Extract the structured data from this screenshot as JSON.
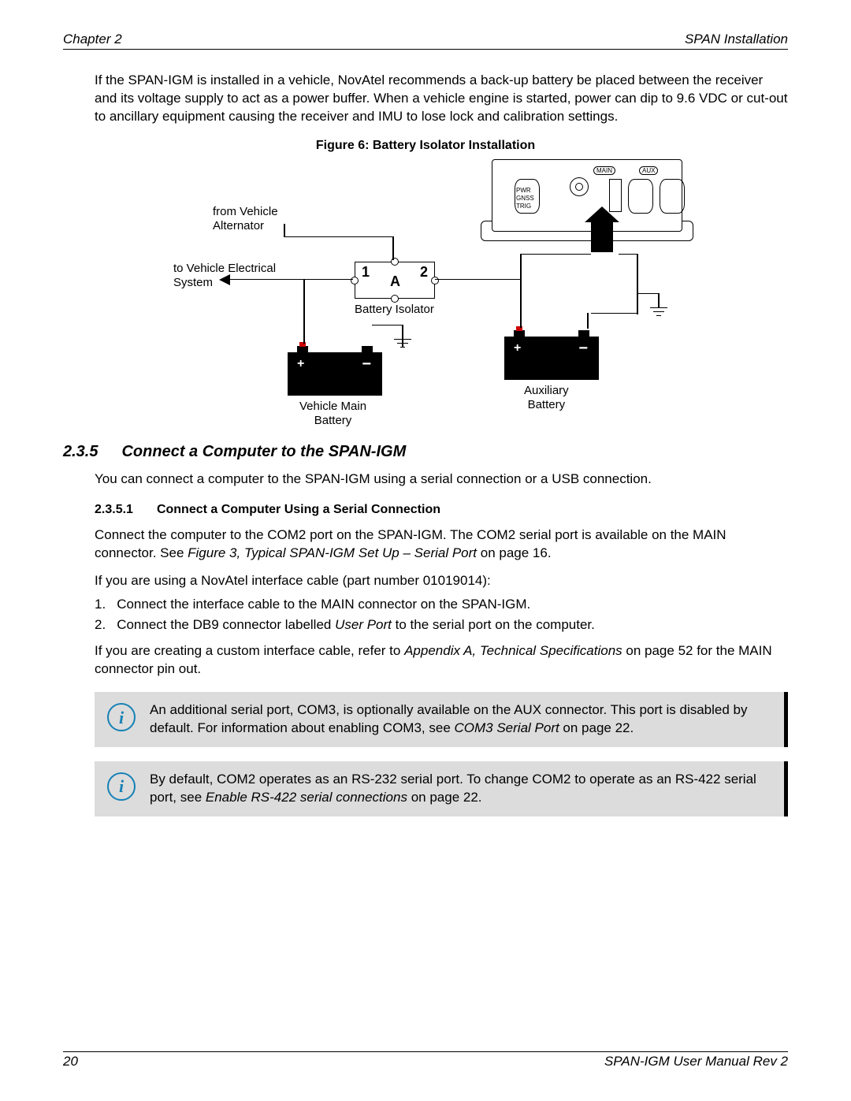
{
  "header": {
    "left": "Chapter 2",
    "right": "SPAN Installation"
  },
  "intro_para": "If the SPAN-IGM is installed in a vehicle, NovAtel recommends a back-up battery be placed between the receiver and its voltage supply to act as a power buffer. When a vehicle engine is started, power can dip to 9.6 VDC or cut-out to ancillary equipment causing the receiver and IMU to lose lock and calibration settings.",
  "figure": {
    "caption": "Figure 6: Battery Isolator Installation",
    "labels": {
      "from_alt_l1": "from Vehicle",
      "from_alt_l2": "Alternator",
      "to_sys_l1": "to Vehicle Electrical",
      "to_sys_l2": "System",
      "isolator": "Battery Isolator",
      "main_batt_l1": "Vehicle Main",
      "main_batt_l2": "Battery",
      "aux_batt_l1": "Auxiliary",
      "aux_batt_l2": "Battery",
      "dev_main": "MAIN",
      "dev_aux": "AUX",
      "dev_pwr": "PWR",
      "dev_gnss": "GNSS",
      "dev_trig": "TRIG"
    }
  },
  "section": {
    "num": "2.3.5",
    "title": "Connect a Computer to the SPAN-IGM"
  },
  "section_para": "You can connect a computer to the SPAN-IGM using a serial connection or a USB connection.",
  "subsection": {
    "num": "2.3.5.1",
    "title": "Connect a Computer Using a Serial Connection"
  },
  "sub_para1_a": "Connect the computer to the COM2 port on the SPAN-IGM. The COM2 serial port is available on the MAIN connector. See ",
  "sub_para1_ref": "Figure 3, Typical SPAN-IGM Set Up – Serial Port",
  "sub_para1_b": " on page 16.",
  "sub_para2": "If you are using a NovAtel interface cable (part number 01019014):",
  "steps": {
    "s1_n": "1.",
    "s1": "Connect the interface cable to the MAIN connector on the SPAN-IGM.",
    "s2_n": "2.",
    "s2_a": "Connect the DB9 connector labelled ",
    "s2_i": "User Port",
    "s2_b": " to the serial port on the computer."
  },
  "sub_para3_a": "If you are creating a custom interface cable, refer to ",
  "sub_para3_ref": "Appendix A, Technical Specifications",
  "sub_para3_b": " on page 52 for the MAIN connector pin out.",
  "note1_a": "An additional serial port, COM3, is optionally available on the AUX connector. This port is disabled by default. For information about enabling COM3, see ",
  "note1_ref": "COM3 Serial Port",
  "note1_b": " on page 22.",
  "note2_a": "By default, COM2 operates as an RS-232 serial port. To change COM2 to operate as an RS-422 serial port, see ",
  "note2_ref": "Enable RS-422 serial connections",
  "note2_b": " on page 22.",
  "footer": {
    "left": "20",
    "right": "SPAN-IGM User Manual Rev 2"
  }
}
